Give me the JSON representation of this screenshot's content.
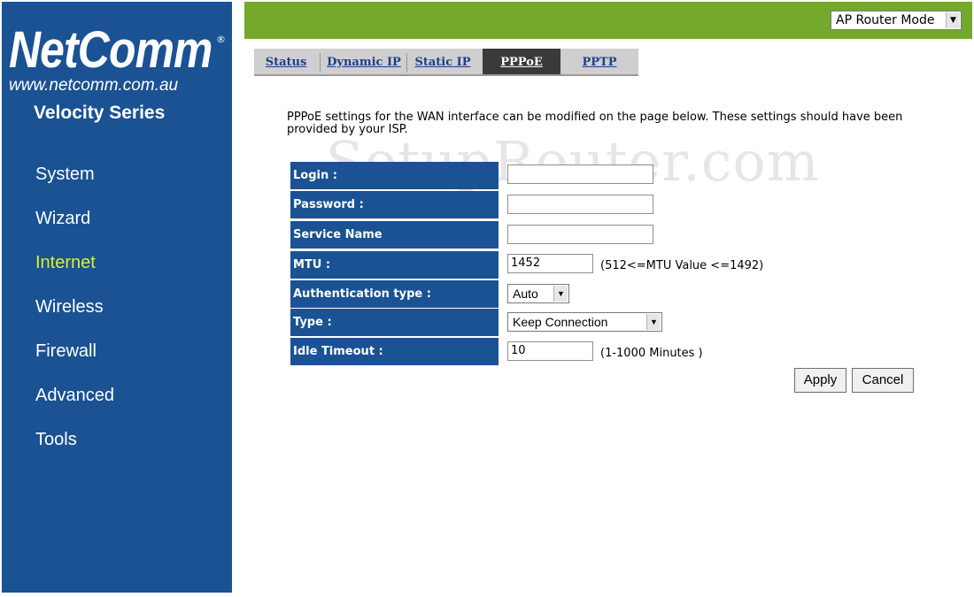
{
  "brand": {
    "logo": "NetComm",
    "registered": "®",
    "url": "www.netcomm.com.au",
    "series": "Velocity Series"
  },
  "sidebar": {
    "items": [
      {
        "label": "System"
      },
      {
        "label": "Wizard"
      },
      {
        "label": "Internet"
      },
      {
        "label": "Wireless"
      },
      {
        "label": "Firewall"
      },
      {
        "label": "Advanced"
      },
      {
        "label": "Tools"
      }
    ],
    "active": "Internet"
  },
  "header": {
    "mode_select": "AP Router Mode"
  },
  "tabs": [
    {
      "label": "Status"
    },
    {
      "label": "Dynamic IP"
    },
    {
      "label": "Static IP"
    },
    {
      "label": "PPPoE"
    },
    {
      "label": "PPTP"
    }
  ],
  "active_tab": "PPPoE",
  "description": "PPPoE settings for the WAN interface can be modified on the page below. These settings should have been provided by your ISP.",
  "watermark": "SetupRouter.com",
  "form": {
    "login": {
      "label": "Login :",
      "value": ""
    },
    "password": {
      "label": "Password :",
      "value": ""
    },
    "service_name": {
      "label": "Service Name",
      "value": ""
    },
    "mtu": {
      "label": "MTU :",
      "value": "1452",
      "hint": "(512<=MTU Value <=1492)"
    },
    "auth_type": {
      "label": "Authentication type :",
      "value": "Auto"
    },
    "type": {
      "label": "Type :",
      "value": "Keep Connection"
    },
    "idle_timeout": {
      "label": "Idle Timeout :",
      "value": "10",
      "hint": "(1-1000 Minutes )"
    }
  },
  "buttons": {
    "apply": "Apply",
    "cancel": "Cancel"
  },
  "colors": {
    "sidebar": "#1a5293",
    "topbar": "#74a92b",
    "active_nav": "#d9f22b",
    "label_bg": "#1a5293"
  }
}
